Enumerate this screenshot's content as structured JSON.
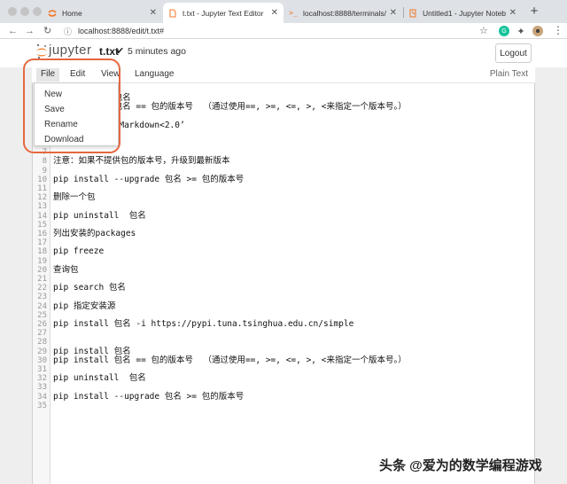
{
  "browser": {
    "tabs": [
      {
        "label": "Home",
        "icon": "jupyter-favicon-icon"
      },
      {
        "label": "t.txt - Jupyter Text Editor",
        "icon": "file-favicon-icon"
      },
      {
        "label": "localhost:8888/terminals/1",
        "icon": "terminal-favicon-icon"
      },
      {
        "label": "Untitled1 - Jupyter Notebook",
        "icon": "notebook-favicon-icon"
      }
    ],
    "url": "localhost:8888/edit/t.txt#",
    "active_tab": 1
  },
  "header": {
    "logo_text": "jupyter",
    "filename": "t.txt",
    "saved_check": "✔",
    "saved_status": "5 minutes ago",
    "logout_label": "Logout"
  },
  "menubar": {
    "items": [
      "File",
      "Edit",
      "View",
      "Language"
    ],
    "mode": "Plain Text"
  },
  "file_menu": {
    "items": [
      "New",
      "Save",
      "Rename",
      "Download"
    ]
  },
  "editor": {
    "lines": [
      {
        "n": "1",
        "text": "pip install 包名"
      },
      {
        "n": "2",
        "text": "pip install 包名 == 包的版本号  （通过使用==, >=, <=, >, <来指定一个版本号。）"
      },
      {
        "n": "3",
        "text": ""
      },
      {
        "n": "4",
        "text": "pip install ‘Markdown<2.0’"
      },
      {
        "n": "5",
        "text": ""
      },
      {
        "n": "6",
        "text": "升级一个包"
      },
      {
        "n": "7",
        "text": ""
      },
      {
        "n": "8",
        "text": "注意：如果不提供包的版本号，升级到最新版本"
      },
      {
        "n": "9",
        "text": ""
      },
      {
        "n": "10",
        "text": "pip install --upgrade 包名 >= 包的版本号"
      },
      {
        "n": "11",
        "text": ""
      },
      {
        "n": "12",
        "text": "删除一个包"
      },
      {
        "n": "13",
        "text": ""
      },
      {
        "n": "14",
        "text": "pip uninstall  包名"
      },
      {
        "n": "15",
        "text": ""
      },
      {
        "n": "16",
        "text": "列出安装的packages"
      },
      {
        "n": "17",
        "text": ""
      },
      {
        "n": "18",
        "text": "pip freeze"
      },
      {
        "n": "19",
        "text": ""
      },
      {
        "n": "20",
        "text": "查询包"
      },
      {
        "n": "21",
        "text": ""
      },
      {
        "n": "22",
        "text": "pip search 包名"
      },
      {
        "n": "23",
        "text": ""
      },
      {
        "n": "24",
        "text": "pip 指定安装源"
      },
      {
        "n": "25",
        "text": ""
      },
      {
        "n": "26",
        "text": "pip install 包名 -i https://pypi.tuna.tsinghua.edu.cn/simple"
      },
      {
        "n": "27",
        "text": ""
      },
      {
        "n": "28",
        "text": ""
      },
      {
        "n": "29",
        "text": "pip install 包名"
      },
      {
        "n": "30",
        "text": "pip install 包名 == 包的版本号  （通过使用==, >=, <=, >, <来指定一个版本号。）"
      },
      {
        "n": "31",
        "text": ""
      },
      {
        "n": "32",
        "text": "pip uninstall  包名"
      },
      {
        "n": "33",
        "text": ""
      },
      {
        "n": "34",
        "text": "pip install --upgrade 包名 >= 包的版本号"
      },
      {
        "n": "35",
        "text": ""
      }
    ]
  },
  "watermark": "头条 @爱为的数学编程游戏",
  "colors": {
    "highlight": "#e4683f",
    "jupyter_orange": "#f37726"
  }
}
